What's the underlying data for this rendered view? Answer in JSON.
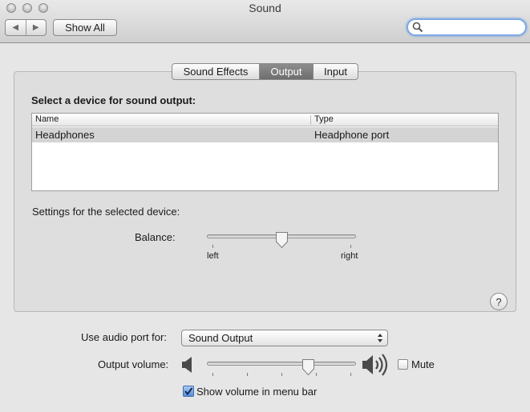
{
  "window": {
    "title": "Sound"
  },
  "toolbar": {
    "back_glyph": "◀",
    "forward_glyph": "▶",
    "show_all_label": "Show All",
    "search_value": "",
    "search_placeholder": ""
  },
  "tabs": [
    {
      "label": "Sound Effects",
      "active": false
    },
    {
      "label": "Output",
      "active": true
    },
    {
      "label": "Input",
      "active": false
    }
  ],
  "output": {
    "heading": "Select a device for sound output:",
    "columns": [
      "Name",
      "Type"
    ],
    "devices": [
      {
        "name": "Headphones",
        "type": "Headphone port",
        "selected": true
      }
    ],
    "settings_label": "Settings for the selected device:",
    "balance": {
      "label": "Balance:",
      "left_label": "left",
      "right_label": "right",
      "value_fraction": 0.5
    },
    "help_glyph": "?"
  },
  "bottom": {
    "audio_port_label": "Use audio port for:",
    "audio_port_value": "Sound Output",
    "output_volume_label": "Output volume:",
    "volume_fraction": 0.68,
    "mute_label": "Mute",
    "mute_checked": false,
    "show_volume_label": "Show volume in menu bar",
    "show_volume_checked": true
  },
  "icons": {
    "speaker_low": "speaker-low-icon",
    "speaker_high": "speaker-high-icon",
    "search": "magnifier-icon",
    "help": "help-icon"
  },
  "colors": {
    "selected_tab": "#7a7a7a",
    "selected_row": "#d4d4d4",
    "search_focus": "#7fa9e6",
    "checkbox_checked": "#5a8fd8"
  }
}
